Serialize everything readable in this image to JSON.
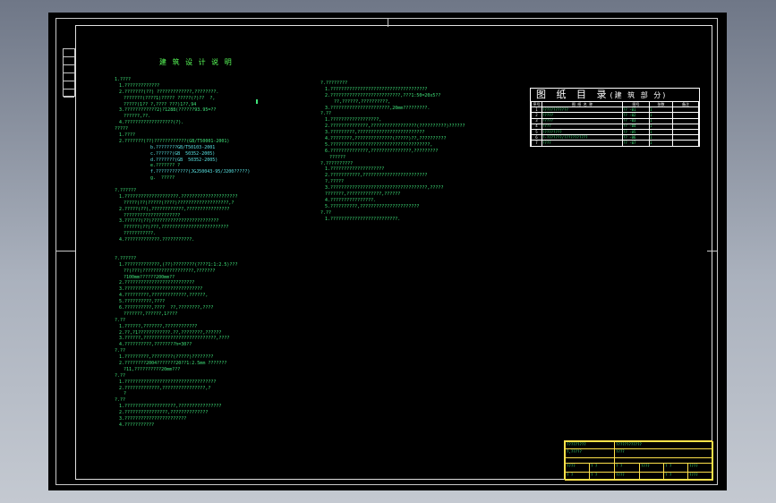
{
  "drawing": {
    "title": "建 筑 设 计 说 明",
    "left_column": [
      {
        "t": "1.????",
        "c": "green",
        "i": 0
      },
      {
        "t": "1.?????????????",
        "c": "green",
        "i": 1
      },
      {
        "t": "2.???????(??) ?????????????,????????.",
        "c": "green",
        "i": 1
      },
      {
        "t": "???????(????1)????? ?????(?)??  ?,",
        "c": "green",
        "i": 2
      },
      {
        "t": "?????(1?? ?,???? ???)1??,94",
        "c": "green",
        "i": 2
      },
      {
        "t": "3.????????????2)?1288(??????93.95=??",
        "c": "green",
        "i": 1
      },
      {
        "t": "??????,??.",
        "c": "green",
        "i": 2
      },
      {
        "t": "4.??????????????????(?).",
        "c": "green",
        "i": 1
      },
      {
        "t": "?????",
        "c": "green",
        "i": 0
      },
      {
        "t": "1.????",
        "c": "green",
        "i": 1
      },
      {
        "t": "2.???????(??)????????????(GB/T50001-2001)",
        "c": "green",
        "i": 1
      },
      {
        "t": "b.????????GB/T50103-2001",
        "c": "cyan",
        "i": 8
      },
      {
        "t": "c.??????(GB  50352-2005)",
        "c": "cyan",
        "i": 8
      },
      {
        "t": "d.???????(GB  50352-2005)",
        "c": "cyan",
        "i": 8
      },
      {
        "t": "e.??????? ?",
        "c": "green",
        "i": 8
      },
      {
        "t": "f.????????????(JGJ50043-95/J200?????)",
        "c": "cyan",
        "i": 8
      },
      {
        "t": "g.  ?????",
        "c": "green",
        "i": 8
      },
      {
        "t": "",
        "c": "green",
        "i": 0
      },
      {
        "t": "?.??????",
        "c": "green",
        "i": 0
      },
      {
        "t": "1.????????????????????.?????????????????????",
        "c": "green",
        "i": 1
      },
      {
        "t": "?????(??)?????(????)???????????????????,?",
        "c": "green",
        "i": 2
      },
      {
        "t": "2.?????(??),????????????,????????????????",
        "c": "green",
        "i": 1
      },
      {
        "t": "?????????????????????",
        "c": "green",
        "i": 2
      },
      {
        "t": "3.??????(??)?????????????????????????",
        "c": "green",
        "i": 1
      },
      {
        "t": "??????(??)???,?????????????????????????",
        "c": "green",
        "i": 2
      },
      {
        "t": "???????????.",
        "c": "green",
        "i": 2
      },
      {
        "t": "4.?????????????.???????????.",
        "c": "green",
        "i": 1
      },
      {
        "t": "",
        "c": "green",
        "i": 0
      },
      {
        "t": "",
        "c": "green",
        "i": 0
      },
      {
        "t": "?.??????",
        "c": "green",
        "i": 0
      },
      {
        "t": "1.?????????????,(??)????????(????1:1:2.5)???",
        "c": "green",
        "i": 1
      },
      {
        "t": "??(???)???????????????????,???????",
        "c": "green",
        "i": 2
      },
      {
        "t": "?100mm??????200mm??",
        "c": "green",
        "i": 2
      },
      {
        "t": "2.??????????????????????????",
        "c": "green",
        "i": 1
      },
      {
        "t": "3.?????????????????????????????",
        "c": "green",
        "i": 1
      },
      {
        "t": "4.?????????,?????????????,??????,",
        "c": "green",
        "i": 1
      },
      {
        "t": "5.??????????,????",
        "c": "green",
        "i": 1
      },
      {
        "t": "6.??????????,????  ??,????????,????",
        "c": "green",
        "i": 1
      },
      {
        "t": "???????,??????,1????",
        "c": "green",
        "i": 2
      },
      {
        "t": "?.??",
        "c": "green",
        "i": 0
      },
      {
        "t": "1.??????,???????,????????????",
        "c": "green",
        "i": 1
      },
      {
        "t": "2.??,?1????????????.??,????????,??????",
        "c": "green",
        "i": 1
      },
      {
        "t": "3.??????,???????????????????????????,????",
        "c": "green",
        "i": 1
      },
      {
        "t": "4.??????????,????????h=30??",
        "c": "green",
        "i": 1
      },
      {
        "t": "?.??",
        "c": "green",
        "i": 0
      },
      {
        "t": "1.?????????,????????(?????)????????",
        "c": "green",
        "i": 1
      },
      {
        "t": "2.????????2004???????20??1:2.5mm ???????",
        "c": "green",
        "i": 1
      },
      {
        "t": "?11,??????????20mm???",
        "c": "green",
        "i": 2
      },
      {
        "t": "?.??",
        "c": "green",
        "i": 0
      },
      {
        "t": "1.??????????????????????????????????",
        "c": "green",
        "i": 1
      },
      {
        "t": "2.?????????????,????????????????,?",
        "c": "green",
        "i": 1
      },
      {
        "t": "?",
        "c": "green",
        "i": 2
      },
      {
        "t": "?.??",
        "c": "green",
        "i": 0
      },
      {
        "t": "1.???????????????????,????????????????",
        "c": "green",
        "i": 1
      },
      {
        "t": "2.????????????????,??????????????",
        "c": "green",
        "i": 1
      },
      {
        "t": "3.???????????????????????",
        "c": "green",
        "i": 1
      },
      {
        "t": "4.???????????",
        "c": "green",
        "i": 1
      }
    ],
    "right_column": [
      {
        "t": "?.????????",
        "c": "green",
        "i": 0
      },
      {
        "t": "1.????????????????????????????????????",
        "c": "green",
        "i": 1
      },
      {
        "t": "2.??????????????????????????,???1:50=20x5??",
        "c": "green",
        "i": 1
      },
      {
        "t": "??,??????,??????????,",
        "c": "green",
        "i": 3
      },
      {
        "t": "3.??????????????????????,20mm?????????.",
        "c": "green",
        "i": 1
      },
      {
        "t": "?.??",
        "c": "green",
        "i": 0
      },
      {
        "t": "1.??????????????????,",
        "c": "green",
        "i": 1
      },
      {
        "t": "2.??????????????,?????????????????(??????????)??????",
        "c": "green",
        "i": 1
      },
      {
        "t": "3.?????????,?????????????????????????",
        "c": "green",
        "i": 1
      },
      {
        "t": "4.????????,??????????????(?????)??,??????????",
        "c": "green",
        "i": 1
      },
      {
        "t": "5.?????????????????????????????????????,",
        "c": "green",
        "i": 1
      },
      {
        "t": "6.??????????????,???????????????,?????????",
        "c": "green",
        "i": 1
      },
      {
        "t": "??????",
        "c": "green",
        "i": 2
      },
      {
        "t": "?.??????????",
        "c": "green",
        "i": 0
      },
      {
        "t": "1.????????????????????",
        "c": "green",
        "i": 1
      },
      {
        "t": "2.???????????,????????????????????????",
        "c": "green",
        "i": 1
      },
      {
        "t": "?.?????",
        "c": "green",
        "i": 1
      },
      {
        "t": "3.????????????????????????????????????,?????",
        "c": "green",
        "i": 1
      },
      {
        "t": "???????,?????????????,??????",
        "c": "green",
        "i": 1
      },
      {
        "t": "4.????????????????.",
        "c": "green",
        "i": 1
      },
      {
        "t": "5.??????????,??????????????????????",
        "c": "green",
        "i": 1
      },
      {
        "t": "?.??",
        "c": "green",
        "i": 0
      },
      {
        "t": "1.?????????????????????????.",
        "c": "green",
        "i": 1
      }
    ],
    "index_table": {
      "title": "图 纸 目 录",
      "subtitle": "(建 筑 部 分)",
      "headers": [
        "序号",
        "图 纸 名 称",
        "图号",
        "张数",
        "备注"
      ],
      "rows": [
        [
          "1",
          "????????????",
          "?? -01",
          "1",
          ""
        ],
        [
          "2",
          "?????",
          "?? -02",
          "1",
          ""
        ],
        [
          "3",
          "?????",
          "?? -03",
          "1",
          ""
        ],
        [
          "4",
          "????",
          "?? -04",
          "1",
          ""
        ],
        [
          "5",
          "?????????",
          "?? -05",
          "1",
          ""
        ],
        [
          "6",
          "?-???????/???????????",
          "?? -06",
          "1",
          ""
        ],
        [
          "7",
          "????",
          "?? -07",
          "1",
          ""
        ]
      ]
    },
    "title_block": {
      "row1": [
        "?????????",
        "????????????"
      ],
      "row2": [
        "?,?????",
        "????"
      ],
      "row3": [
        "????",
        "? ?",
        "? ?",
        "????",
        "? ?",
        "????"
      ],
      "row4": [
        "? ?",
        "? ?",
        "????",
        "",
        "? ?",
        "????"
      ]
    }
  }
}
